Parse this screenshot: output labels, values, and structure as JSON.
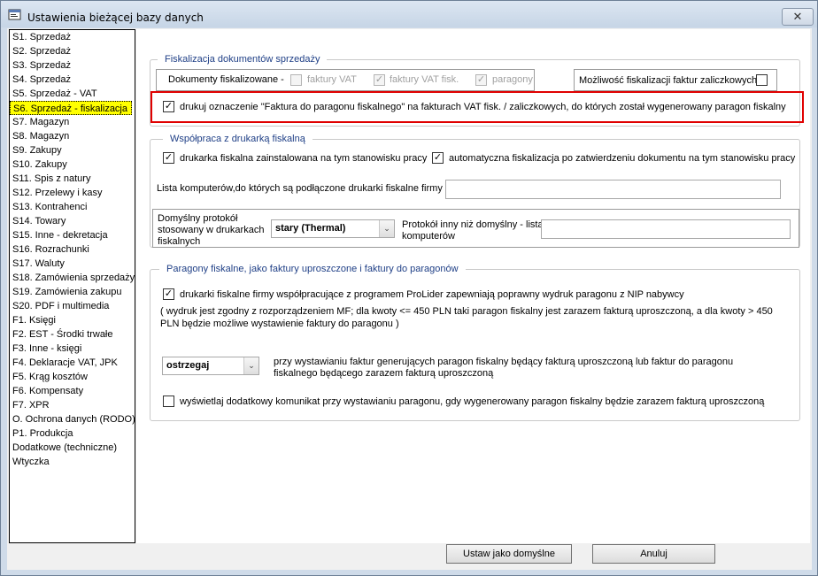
{
  "window": {
    "title": "Ustawienia bieżącej bazy danych",
    "close_glyph": "✕"
  },
  "sidebar": {
    "items": [
      {
        "label": "S1. Sprzedaż"
      },
      {
        "label": "S2. Sprzedaż"
      },
      {
        "label": "S3. Sprzedaż"
      },
      {
        "label": "S4. Sprzedaż"
      },
      {
        "label": "S5. Sprzedaż - VAT"
      },
      {
        "label": "S6. Sprzedaż - fiskalizacja",
        "selected": true
      },
      {
        "label": "S7. Magazyn"
      },
      {
        "label": "S8. Magazyn"
      },
      {
        "label": "S9. Zakupy"
      },
      {
        "label": "S10. Zakupy"
      },
      {
        "label": "S11. Spis z natury"
      },
      {
        "label": "S12. Przelewy i kasy"
      },
      {
        "label": "S13. Kontrahenci"
      },
      {
        "label": "S14. Towary"
      },
      {
        "label": "S15. Inne - dekretacja"
      },
      {
        "label": "S16. Rozrachunki"
      },
      {
        "label": "S17. Waluty"
      },
      {
        "label": "S18. Zamówienia sprzedaży"
      },
      {
        "label": "S19. Zamówienia zakupu"
      },
      {
        "label": "S20. PDF i multimedia"
      },
      {
        "label": "F1. Księgi"
      },
      {
        "label": "F2. EST - Środki trwałe"
      },
      {
        "label": "F3. Inne - księgi"
      },
      {
        "label": "F4. Deklaracje VAT, JPK"
      },
      {
        "label": "F5. Krąg kosztów"
      },
      {
        "label": "F6. Kompensaty"
      },
      {
        "label": "F7. XPR"
      },
      {
        "label": "O. Ochrona danych (RODO)"
      },
      {
        "label": "P1. Produkcja"
      },
      {
        "label": "Dodatkowe (techniczne)"
      },
      {
        "label": "Wtyczka"
      }
    ],
    "selected_color": "#ffff00"
  },
  "fiskalizacja": {
    "legend": "Fiskalizacja dokumentów sprzedaży",
    "docs_label": "Dokumenty fiskalizowane -",
    "faktury_vat": "faktury VAT",
    "faktury_vat_fisk": "faktury VAT fisk.",
    "paragony": "paragony",
    "zaliczkowe": "Możliwość fiskalizacji faktur zaliczkowych",
    "drukuj": "drukuj oznaczenie \"Faktura do paragonu fiskalnego\" na fakturach VAT fisk. / zaliczkowych, do których został wygenerowany paragon fiskalny"
  },
  "wspolpraca": {
    "legend": "Współpraca z drukarką fiskalną",
    "drukarka_zainstalowana": "drukarka fiskalna zainstalowana na tym stanowisku pracy",
    "automatyczna": "automatyczna fiskalizacja po zatwierdzeniu dokumentu na tym stanowisku pracy",
    "lista_komputerow": "Lista komputerów,do których są podłączone drukarki fiskalne firmy",
    "protokol_label": "Domyślny protokół stosowany w drukarkach fiskalnych",
    "protokol_value": "stary (Thermal)",
    "protokol_inny": "Protokół inny niż domyślny - lista komputerów"
  },
  "paragony": {
    "legend": "Paragony fiskalne, jako faktury uproszczone i faktury do paragonów",
    "drukarki_nip": "drukarki fiskalne firmy współpracujące z programem ProLider zapewniają poprawny wydruk paragonu z NIP nabywcy",
    "note": "( wydruk jest zgodny z rozporządzeniem MF; dla kwoty <= 450 PLN taki paragon fiskalny jest zarazem fakturą uproszczoną, a dla kwoty > 450 PLN będzie możliwe wystawienie faktury do paragonu )",
    "ostrzegaj_value": "ostrzegaj",
    "ostrzegaj_desc": "przy wystawianiu faktur generujących paragon fiskalny będący fakturą uproszczoną lub faktur do paragonu fiskalnego będącego zarazem fakturą uproszczoną",
    "komunikat": "wyświetlaj dodatkowy komunikat przy wystawianiu paragonu, gdy wygenerowany paragon fiskalny będzie zarazem fakturą uproszczoną"
  },
  "buttons": {
    "default": "Ustaw jako domyślne",
    "cancel": "Anuluj"
  },
  "check_glyph": "✓",
  "arrow_glyph": "⌄",
  "highlight_color": "#e00000"
}
